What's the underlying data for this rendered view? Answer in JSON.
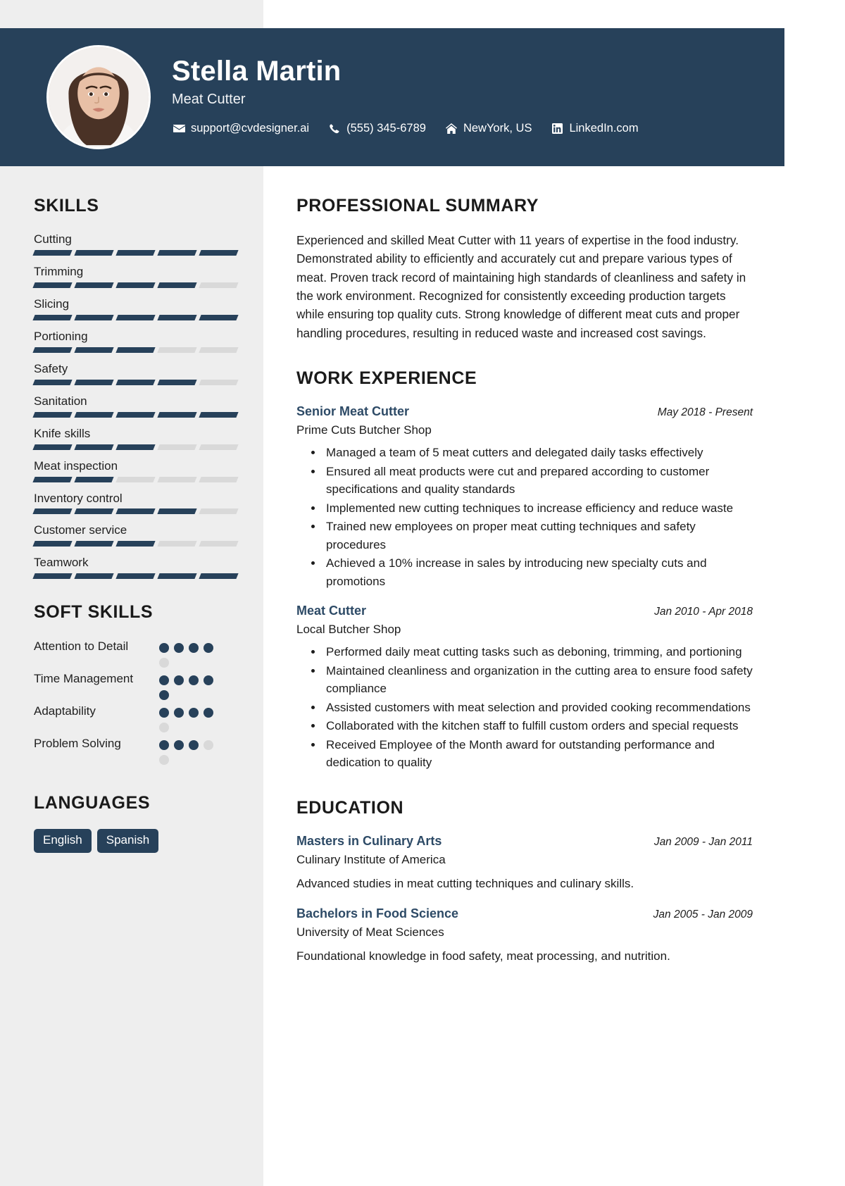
{
  "header": {
    "name": "Stella Martin",
    "job_title": "Meat Cutter",
    "accent_color": "#27415a",
    "contacts": [
      {
        "icon": "envelope-icon",
        "text": "support@cvdesigner.ai"
      },
      {
        "icon": "phone-icon",
        "text": "(555) 345-6789"
      },
      {
        "icon": "home-icon",
        "text": "NewYork, US"
      },
      {
        "icon": "linkedin-icon",
        "text": "LinkedIn.com"
      }
    ]
  },
  "sidebar": {
    "skills_heading": "SKILLS",
    "skills": [
      {
        "label": "Cutting",
        "level": 5,
        "max": 5
      },
      {
        "label": "Trimming",
        "level": 4,
        "max": 5
      },
      {
        "label": "Slicing",
        "level": 5,
        "max": 5
      },
      {
        "label": "Portioning",
        "level": 3,
        "max": 5
      },
      {
        "label": "Safety",
        "level": 4,
        "max": 5
      },
      {
        "label": "Sanitation",
        "level": 5,
        "max": 5
      },
      {
        "label": "Knife skills",
        "level": 3,
        "max": 5
      },
      {
        "label": "Meat inspection",
        "level": 2,
        "max": 5
      },
      {
        "label": "Inventory control",
        "level": 4,
        "max": 5
      },
      {
        "label": "Customer service",
        "level": 3,
        "max": 5
      },
      {
        "label": "Teamwork",
        "level": 5,
        "max": 5
      }
    ],
    "soft_skills_heading": "SOFT SKILLS",
    "soft_skills": [
      {
        "label": "Attention to Detail",
        "level": 4,
        "max": 5
      },
      {
        "label": "Time Management",
        "level": 5,
        "max": 5
      },
      {
        "label": "Adaptability",
        "level": 4,
        "max": 5
      },
      {
        "label": "Problem Solving",
        "level": 3,
        "max": 5
      }
    ],
    "languages_heading": "LANGUAGES",
    "languages": [
      "English",
      "Spanish"
    ]
  },
  "main": {
    "summary_heading": "PROFESSIONAL SUMMARY",
    "summary_text": "Experienced and skilled Meat Cutter with 11 years of expertise in the food industry. Demonstrated ability to efficiently and accurately cut and prepare various types of meat. Proven track record of maintaining high standards of cleanliness and safety in the work environment. Recognized for consistently exceeding production targets while ensuring top quality cuts. Strong knowledge of different meat cuts and proper handling procedures, resulting in reduced waste and increased cost savings.",
    "experience_heading": "WORK EXPERIENCE",
    "experience": [
      {
        "title": "Senior Meat Cutter",
        "date": "May 2018 - Present",
        "org": "Prime Cuts Butcher Shop",
        "bullets": [
          "Managed a team of 5 meat cutters and delegated daily tasks effectively",
          "Ensured all meat products were cut and prepared according to customer specifications and quality standards",
          "Implemented new cutting techniques to increase efficiency and reduce waste",
          "Trained new employees on proper meat cutting techniques and safety procedures",
          "Achieved a 10% increase in sales by introducing new specialty cuts and promotions"
        ]
      },
      {
        "title": "Meat Cutter",
        "date": "Jan 2010 - Apr 2018",
        "org": "Local Butcher Shop",
        "bullets": [
          "Performed daily meat cutting tasks such as deboning, trimming, and portioning",
          "Maintained cleanliness and organization in the cutting area to ensure food safety compliance",
          "Assisted customers with meat selection and provided cooking recommendations",
          "Collaborated with the kitchen staff to fulfill custom orders and special requests",
          "Received Employee of the Month award for outstanding performance and dedication to quality"
        ]
      }
    ],
    "education_heading": "EDUCATION",
    "education": [
      {
        "title": "Masters in Culinary Arts",
        "date": "Jan 2009 - Jan 2011",
        "org": "Culinary Institute of America",
        "desc": "Advanced studies in meat cutting techniques and culinary skills."
      },
      {
        "title": "Bachelors in Food Science",
        "date": "Jan 2005 - Jan 2009",
        "org": "University of Meat Sciences",
        "desc": "Foundational knowledge in food safety, meat processing, and nutrition."
      }
    ]
  }
}
